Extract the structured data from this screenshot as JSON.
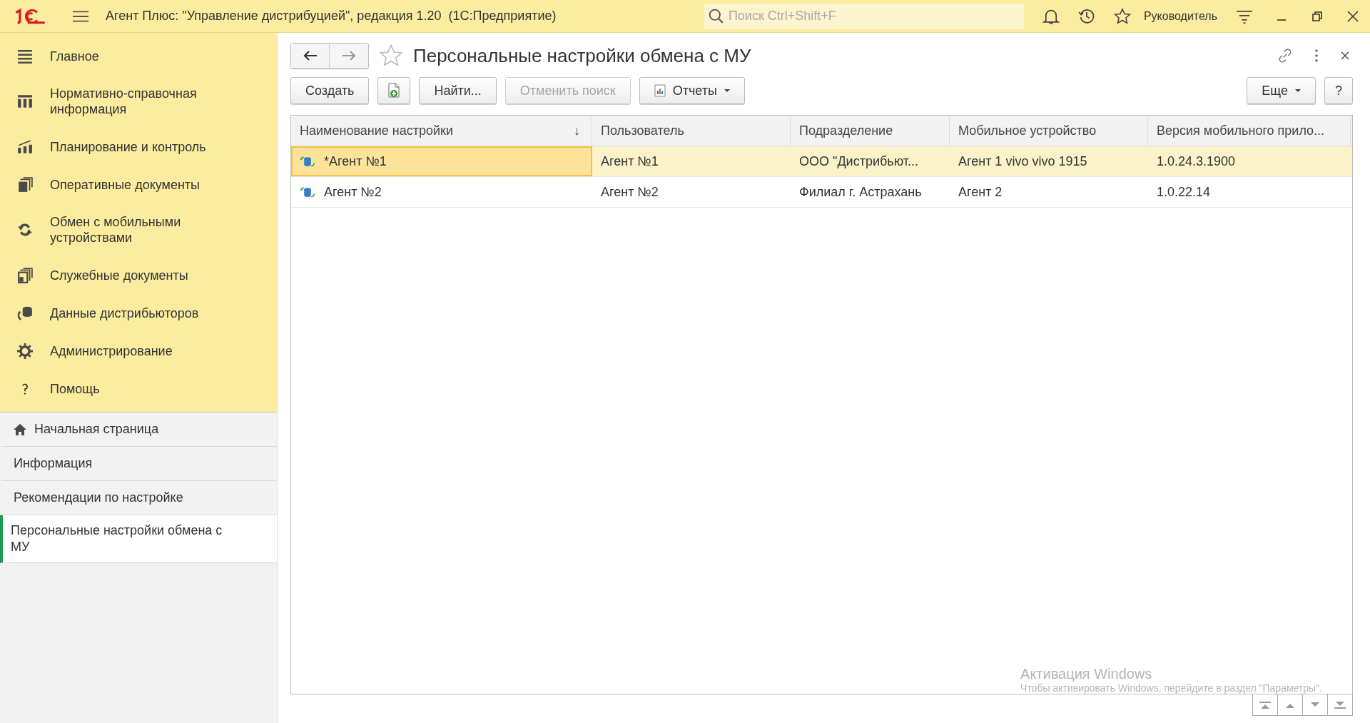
{
  "title_bar": {
    "app_title": "Агент Плюс: \"Управление дистрибуцией\", редакция 1.20  (1С:Предприятие)",
    "search": {
      "placeholder": "Поиск Ctrl+Shift+F"
    },
    "user": "Руководитель"
  },
  "sidebar": {
    "sections": [
      {
        "label": "Главное"
      },
      {
        "label": "Нормативно-справочная информация"
      },
      {
        "label": "Планирование и контроль"
      },
      {
        "label": "Оперативные документы"
      },
      {
        "label": "Обмен с мобильными устройствами"
      },
      {
        "label": "Служебные документы"
      },
      {
        "label": "Данные дистрибьюторов"
      },
      {
        "label": "Администрирование"
      },
      {
        "label": "Помощь"
      }
    ],
    "open_pages": [
      {
        "label": "Начальная страница",
        "kind": "home",
        "selected": false
      },
      {
        "label": "Информация",
        "kind": "page",
        "selected": false
      },
      {
        "label": "Рекомендации по настройке",
        "kind": "page",
        "selected": false
      },
      {
        "label": "Персональные настройки обмена с МУ",
        "kind": "page",
        "selected": true
      }
    ]
  },
  "form": {
    "title": "Персональные настройки обмена с МУ",
    "favorite": false,
    "toolbar": [
      {
        "kind": "text",
        "label": "Создать",
        "disabled": false
      },
      {
        "kind": "copy",
        "disabled": false
      },
      {
        "kind": "text",
        "label": "Найти...",
        "disabled": false
      },
      {
        "kind": "text",
        "label": "Отменить поиск",
        "disabled": true
      },
      {
        "kind": "menu",
        "label": "Отчеты",
        "disabled": false
      }
    ],
    "toolbar_right": [
      {
        "kind": "menu",
        "label": "Еще"
      },
      {
        "kind": "text",
        "label": "?"
      }
    ],
    "table": {
      "columns": [
        {
          "label": "Наименование настройки",
          "sort_mark": "↓"
        },
        {
          "label": "Пользователь"
        },
        {
          "label": "Подразделение"
        },
        {
          "label": "Мобильное устройство"
        },
        {
          "label": "Версия мобильного прило..."
        }
      ],
      "rows": [
        {
          "selected": true,
          "cells": [
            "*Агент №1",
            "Агент №1",
            "ООО \"Дистрибьют...",
            "Агент 1 vivo vivo 1915",
            "1.0.24.3.1900"
          ]
        },
        {
          "selected": false,
          "cells": [
            "Агент №2",
            "Агент №2",
            "Филиал г. Астрахань",
            "Агент 2",
            "1.0.22.14"
          ]
        }
      ]
    }
  },
  "os_notice": {
    "title": "Активация Windows",
    "text": "Чтобы активировать Windows, перейдите в раздел \"Параметры\"."
  }
}
